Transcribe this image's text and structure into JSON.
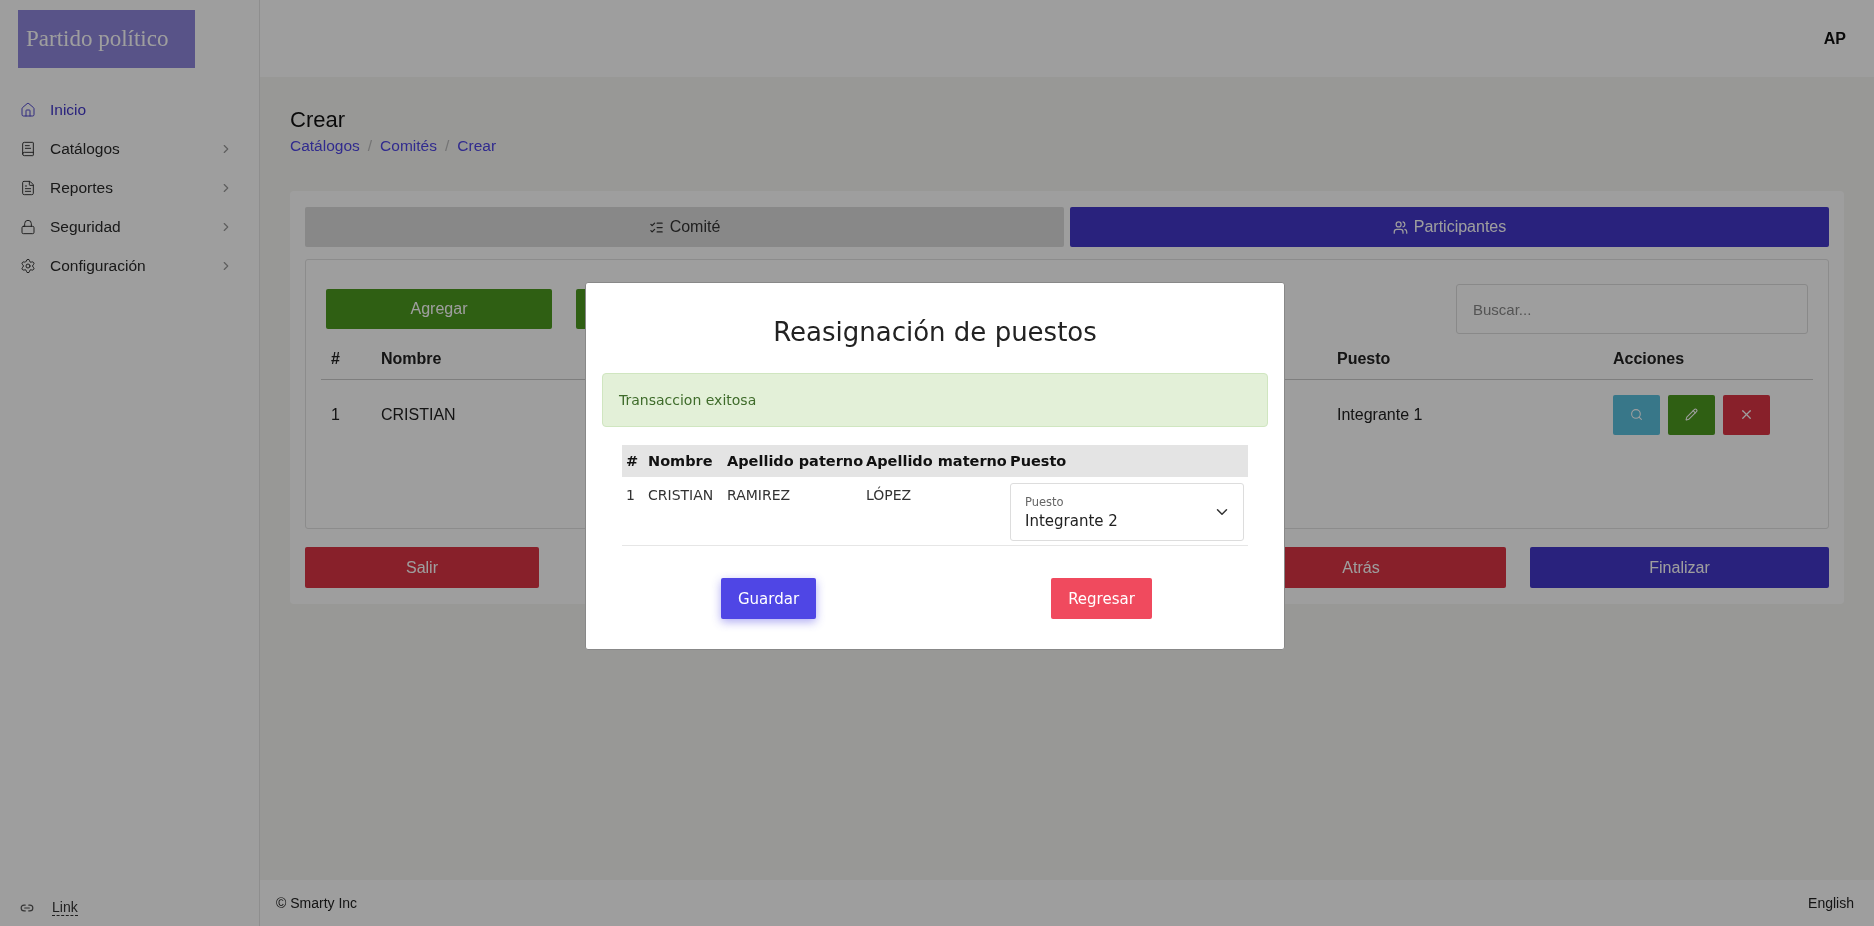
{
  "sidebar": {
    "logo": "Partido político",
    "items": [
      {
        "label": "Inicio",
        "selected": true,
        "has_submenu": false
      },
      {
        "label": "Catálogos",
        "selected": false,
        "has_submenu": true
      },
      {
        "label": "Reportes",
        "selected": false,
        "has_submenu": true
      },
      {
        "label": "Seguridad",
        "selected": false,
        "has_submenu": true
      },
      {
        "label": "Configuración",
        "selected": false,
        "has_submenu": true
      }
    ],
    "footer_link": "Link"
  },
  "header": {
    "avatar": "AP"
  },
  "page": {
    "title": "Crear",
    "breadcrumbs": [
      "Catálogos",
      "Comités",
      "Crear"
    ],
    "breadcrumb_separator": "/"
  },
  "tabs": [
    {
      "label": "Comité",
      "selected": false
    },
    {
      "label": "Participantes",
      "selected": true
    }
  ],
  "toolbar": {
    "add_button": "Agregar",
    "search": {
      "placeholder": "Buscar..."
    }
  },
  "table": {
    "columns": [
      "#",
      "Nombre",
      "Puesto",
      "Acciones"
    ],
    "rows": [
      {
        "number": "1",
        "nombre": "CRISTIAN",
        "puesto": "Integrante 1"
      }
    ]
  },
  "nav_buttons": {
    "exit": "Salir",
    "back": "Atrás",
    "finish": "Finalizar"
  },
  "modal": {
    "title": "Reasignación de puestos",
    "alert": "Transaccion exitosa",
    "columns": [
      "#",
      "Nombre",
      "Apellido paterno",
      "Apellido materno",
      "Puesto"
    ],
    "rows": [
      {
        "number": "1",
        "nombre": "CRISTIAN",
        "apellido_paterno": "RAMIREZ",
        "apellido_materno": "LÓPEZ",
        "puesto": {
          "label": "Puesto",
          "value": "Integrante 2"
        }
      }
    ],
    "buttons": {
      "save": "Guardar",
      "back": "Regresar"
    }
  },
  "footer": {
    "copyright": "© Smarty Inc",
    "language": "English"
  }
}
